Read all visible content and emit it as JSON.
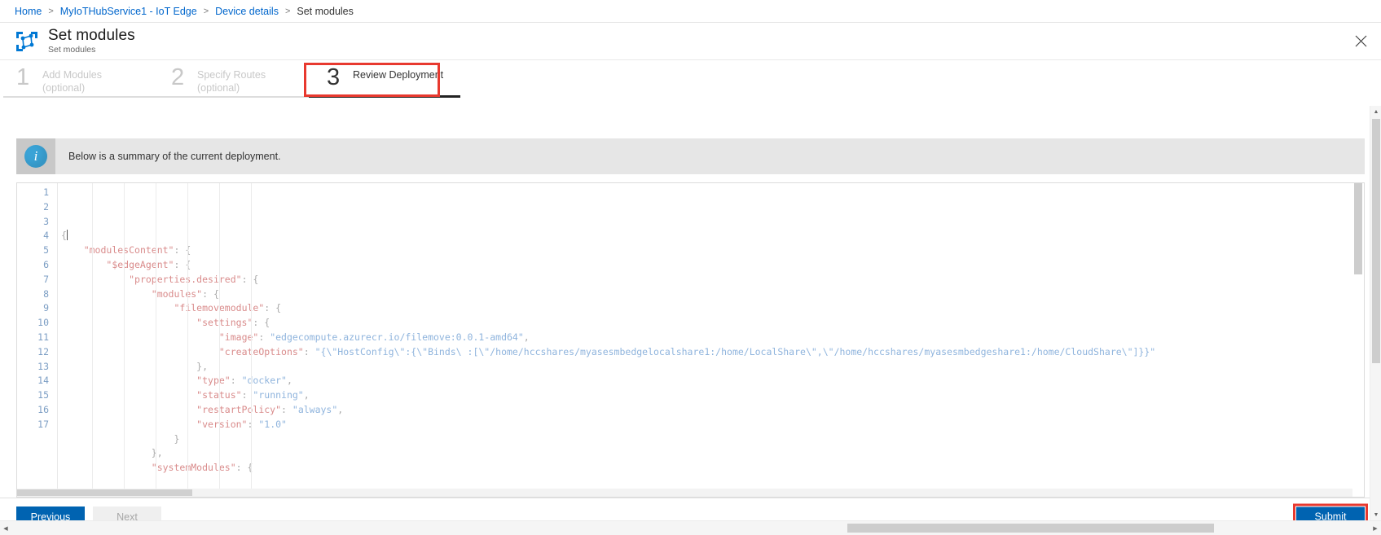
{
  "breadcrumb": {
    "items": [
      {
        "label": "Home",
        "link": true
      },
      {
        "label": "MyIoTHubService1 - IoT Edge",
        "link": true
      },
      {
        "label": "Device details",
        "link": true
      },
      {
        "label": "Set modules",
        "link": false
      }
    ],
    "separator": ">"
  },
  "header": {
    "title": "Set modules",
    "subtitle": "Set modules",
    "icon": "set-modules-icon",
    "close_icon": "close-icon"
  },
  "steps": [
    {
      "number": "1",
      "label": "Add Modules",
      "optional": "(optional)",
      "active": false
    },
    {
      "number": "2",
      "label": "Specify Routes",
      "optional": "(optional)",
      "active": false
    },
    {
      "number": "3",
      "label": "Review Deployment",
      "optional": "",
      "active": true
    }
  ],
  "highlight_color": "#e8392f",
  "accent_color": "#0063b1",
  "info": {
    "icon": "info-icon",
    "message": "Below is a summary of the current deployment."
  },
  "editor": {
    "line_numbers": [
      "1",
      "2",
      "3",
      "4",
      "5",
      "6",
      "7",
      "8",
      "9",
      "10",
      "11",
      "12",
      "13",
      "14",
      "15",
      "16",
      "17"
    ],
    "lines": [
      "{",
      "    \"modulesContent\": {",
      "        \"$edgeAgent\": {",
      "            \"properties.desired\": {",
      "                \"modules\": {",
      "                    \"filemovemodule\": {",
      "                        \"settings\": {",
      "                            \"image\": \"edgecompute.azurecr.io/filemove:0.0.1-amd64\",",
      "                            \"createOptions\": \"{\\\"HostConfig\\\":{\\\"Binds\\ :[\\\"/home/hccshares/myasesmbedgelocalshare1:/home/LocalShare\\\",\\\"/home/hccshares/myasesmbedgeshare1:/home/CloudShare\\\"]}}\"",
      "                        },",
      "                        \"type\": \"docker\",",
      "                        \"status\": \"running\",",
      "                        \"restartPolicy\": \"always\",",
      "                        \"version\": \"1.0\"",
      "                    }",
      "                },",
      "                \"systemModules\": {"
    ]
  },
  "footer": {
    "previous_label": "Previous",
    "next_label": "Next",
    "submit_label": "Submit"
  },
  "scrollbars": {
    "up_arrow": "▲",
    "down_arrow": "▼",
    "left_arrow": "◀",
    "right_arrow": "▶"
  }
}
